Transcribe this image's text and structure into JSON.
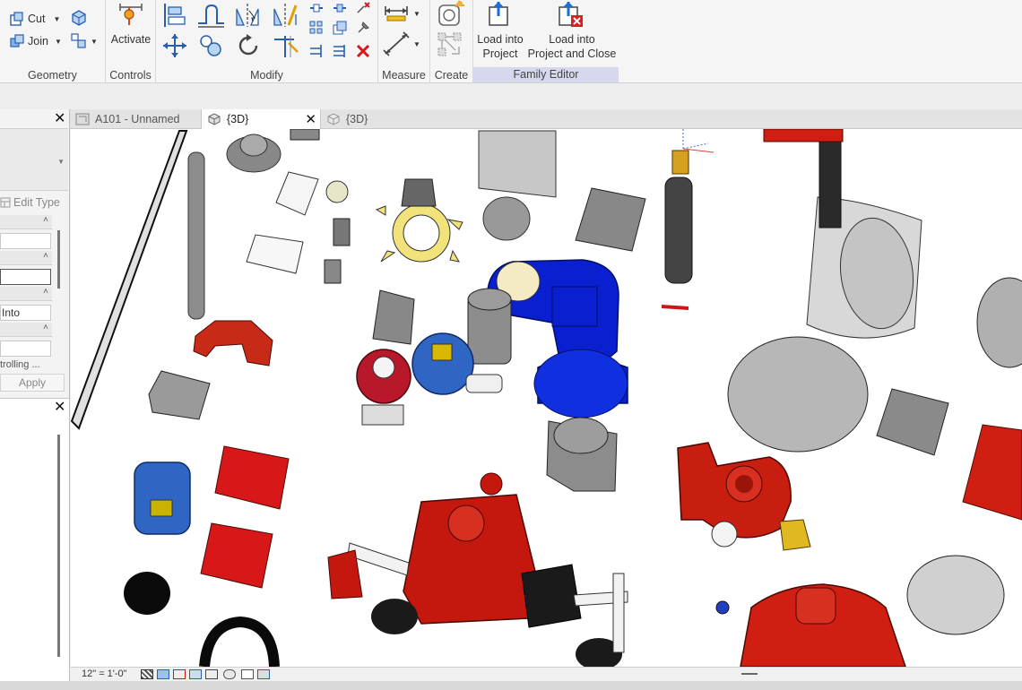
{
  "ribbon": {
    "geometry": {
      "label": "Geometry",
      "cut": "Cut",
      "join": "Join"
    },
    "controls": {
      "label": "Controls",
      "activate": "Activate"
    },
    "modify": {
      "label": "Modify"
    },
    "measure": {
      "label": "Measure"
    },
    "create": {
      "label": "Create"
    },
    "family_editor": {
      "label": "Family Editor",
      "load_into_project": "Load into\nProject",
      "load_into_project_close": "Load into\nProject and Close"
    }
  },
  "view_tabs": [
    {
      "label": "A101 - Unnamed",
      "active": false
    },
    {
      "label": "{3D}",
      "active": true
    },
    {
      "label": "{3D}",
      "active": false
    }
  ],
  "properties": {
    "edit_type": "Edit Type",
    "field_value": "Into",
    "field_trunc": "trolling ...",
    "apply": "Apply"
  },
  "status": {
    "scale": "12\" = 1'-0\""
  },
  "colors": {
    "accent": "#d7d7ee",
    "red": "#d01f12",
    "blue": "#0a1fd0"
  }
}
